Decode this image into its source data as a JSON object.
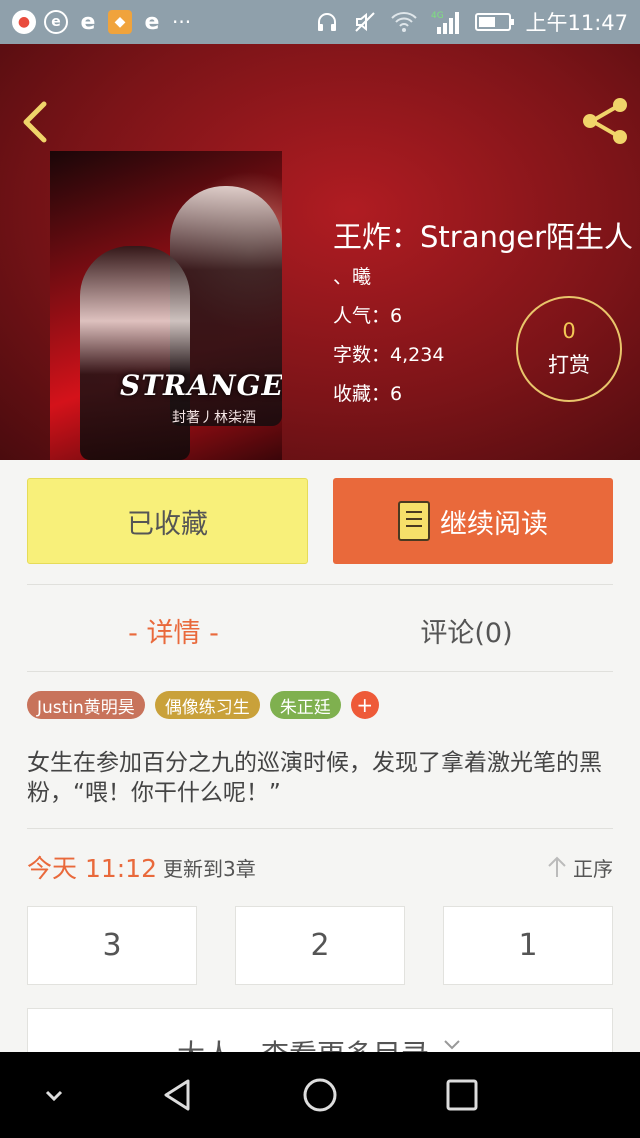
{
  "status_bar": {
    "apps": [
      {
        "name": "chrome-like-icon",
        "glyph": "●",
        "color": "#e94c3d"
      },
      {
        "name": "ie-icon",
        "glyph": "e",
        "color": "#3aa74a"
      },
      {
        "name": "ie-icon",
        "glyph": "e",
        "color": "#3aa74a"
      },
      {
        "name": "puzzle-icon",
        "glyph": "◆",
        "color": "#e9a63b"
      },
      {
        "name": "ie-icon",
        "glyph": "e",
        "color": "#3aa74a"
      }
    ],
    "more": "···",
    "network_label": "4G",
    "time": "上午11:47",
    "battery_level": 0.55
  },
  "book": {
    "title": "王炸：Stranger陌生人",
    "author": "、曦",
    "popularity_label": "人气：",
    "popularity": "6",
    "words_label": "字数：",
    "words": "4,234",
    "favorites_label": "收藏：",
    "favorites": "6",
    "cover_title": "STRANGER",
    "cover_credit": "封著丿林柒酒"
  },
  "tip": {
    "count": "0",
    "label": "打赏"
  },
  "actions": {
    "favorited_label": "已收藏",
    "continue_label": "继续阅读"
  },
  "tabs": {
    "detail": "- 详情 -",
    "comments": "评论(0)"
  },
  "tags": [
    {
      "label": "Justin黄明昊",
      "color": "#c8735b"
    },
    {
      "label": "偶像练习生",
      "color": "#c9a13a"
    },
    {
      "label": "朱正廷",
      "color": "#7fb04f"
    }
  ],
  "tag_add": "+",
  "intro": "女生在参加百分之九的巡演时候，发现了拿着激光笔的黑粉，“喂！你干什么呢！”",
  "update": {
    "time": "今天 11:12",
    "text": "更新到3章",
    "sort_label": "正序"
  },
  "chapters": [
    "3",
    "2",
    "1"
  ],
  "more_label": "大人，查看更多目录",
  "colors": {
    "accent": "#e9693b",
    "fav_button": "#f8f07a",
    "hero": "#8a141a"
  }
}
